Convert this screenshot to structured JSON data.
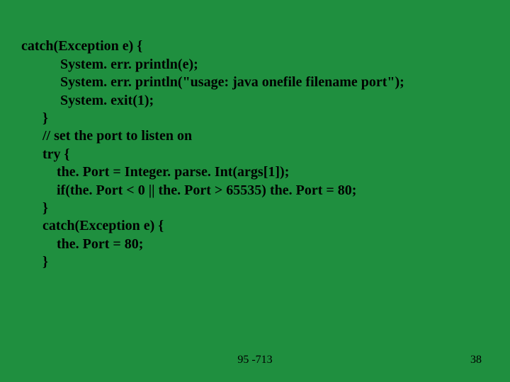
{
  "code": {
    "lines": [
      "catch(Exception e) {",
      "           System. err. println(e);",
      "           System. err. println(\"usage: java onefile filename port\");",
      "           System. exit(1);",
      "      }",
      "      // set the port to listen on",
      "      try {",
      "          the. Port = Integer. parse. Int(args[1]);",
      "          if(the. Port < 0 || the. Port > 65535) the. Port = 80;",
      "      }",
      "      catch(Exception e) {",
      "          the. Port = 80;",
      "      }"
    ]
  },
  "footer": {
    "center": "95 -713",
    "right": "38"
  }
}
